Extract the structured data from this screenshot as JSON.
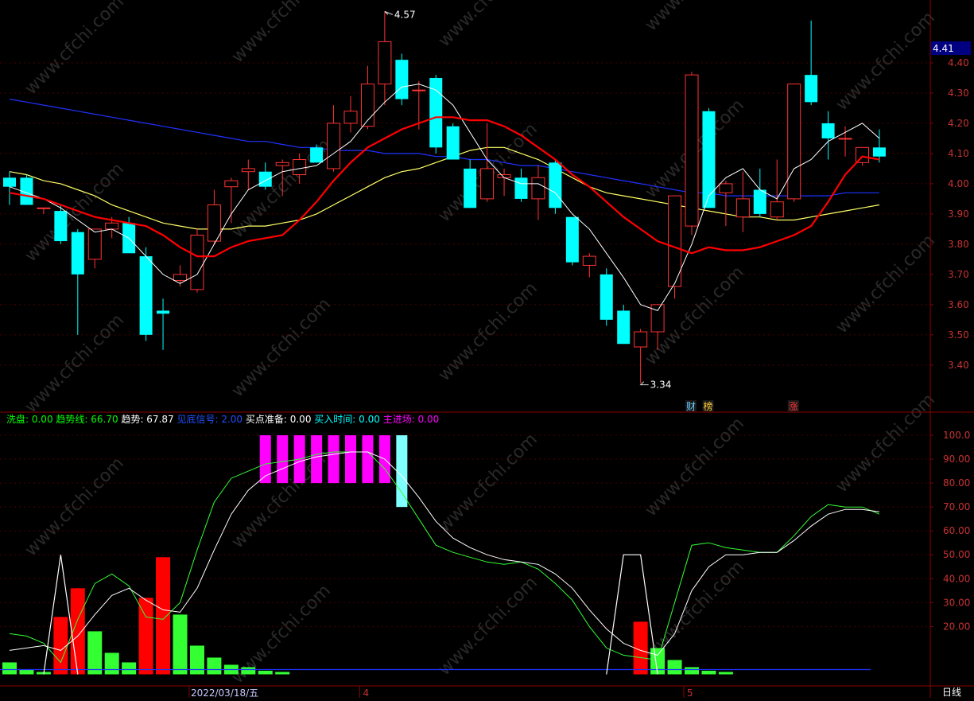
{
  "colors": {
    "bg": "#000000",
    "frame": "#8b0000",
    "grid": "#4a0000",
    "axis_text": "#c83232",
    "up": "#ff3232",
    "down": "#00ffff",
    "ma5": "#ffffff",
    "ma10": "#ff0000",
    "ma20": "#ffff66",
    "ma60": "#1e32ff",
    "price_tag": "#000080"
  },
  "price_axis": {
    "ticks": [
      "4.40",
      "4.30",
      "4.20",
      "4.10",
      "4.00",
      "3.90",
      "3.80",
      "3.70",
      "3.60",
      "3.50",
      "3.40"
    ],
    "last": "4.41"
  },
  "annotations": {
    "high": "4.57",
    "low": "3.34"
  },
  "markers": [
    {
      "text": "财",
      "color": "#66ccff",
      "bar": 40
    },
    {
      "text": "榜",
      "color": "#ffcc33",
      "bar": 41
    },
    {
      "text": "涨",
      "color": "#ff3333",
      "bar": 46
    }
  ],
  "indicator_legend": [
    {
      "label": "洗盘:",
      "value": "0.00",
      "color": "#00ff00"
    },
    {
      "label": "趋势线:",
      "value": "66.70",
      "color": "#00ff00"
    },
    {
      "label": "趋势:",
      "value": "67.87",
      "color": "#ffffff"
    },
    {
      "label": "见底信号:",
      "value": "2.00",
      "color": "#1e50ff"
    },
    {
      "label": "买点准备:",
      "value": "0.00",
      "color": "#ffffff"
    },
    {
      "label": "买入时间:",
      "value": "0.00",
      "color": "#00ffff"
    },
    {
      "label": "主进场:",
      "value": "0.00",
      "color": "#ff00ff"
    }
  ],
  "ind_axis": {
    "ticks": [
      "100.0",
      "90.00",
      "80.00",
      "70.00",
      "60.00",
      "50.00",
      "40.00",
      "30.00",
      "20.00"
    ]
  },
  "date_axis": {
    "labels": [
      {
        "text": "2022/03/18/五",
        "bar": 11
      },
      {
        "text": "4",
        "bar": 21
      },
      {
        "text": "5",
        "bar": 40
      }
    ],
    "period": "日线"
  },
  "watermark": "www.cfchi.com",
  "chart_data": {
    "type": "candlestick",
    "ylim": [
      3.31,
      4.6
    ],
    "candles": [
      {
        "o": 4.02,
        "h": 4.04,
        "l": 3.93,
        "c": 3.99
      },
      {
        "o": 4.02,
        "h": 4.03,
        "l": 3.94,
        "c": 3.93
      },
      {
        "o": 3.92,
        "h": 3.92,
        "l": 3.9,
        "c": 3.92
      },
      {
        "o": 3.91,
        "h": 3.93,
        "l": 3.8,
        "c": 3.81
      },
      {
        "o": 3.84,
        "h": 3.85,
        "l": 3.5,
        "c": 3.7
      },
      {
        "o": 3.75,
        "h": 3.85,
        "l": 3.72,
        "c": 3.85
      },
      {
        "o": 3.85,
        "h": 3.89,
        "l": 3.82,
        "c": 3.87
      },
      {
        "o": 3.87,
        "h": 3.89,
        "l": 3.83,
        "c": 3.77
      },
      {
        "o": 3.76,
        "h": 3.79,
        "l": 3.48,
        "c": 3.5
      },
      {
        "o": 3.58,
        "h": 3.62,
        "l": 3.45,
        "c": 3.57
      },
      {
        "o": 3.68,
        "h": 3.73,
        "l": 3.66,
        "c": 3.7
      },
      {
        "o": 3.65,
        "h": 3.85,
        "l": 3.64,
        "c": 3.83
      },
      {
        "o": 3.81,
        "h": 3.98,
        "l": 3.8,
        "c": 3.93
      },
      {
        "o": 3.99,
        "h": 4.02,
        "l": 3.87,
        "c": 4.01
      },
      {
        "o": 4.04,
        "h": 4.08,
        "l": 3.98,
        "c": 4.05
      },
      {
        "o": 4.04,
        "h": 4.07,
        "l": 3.98,
        "c": 3.99
      },
      {
        "o": 4.06,
        "h": 4.08,
        "l": 3.96,
        "c": 4.07
      },
      {
        "o": 4.03,
        "h": 4.1,
        "l": 4.0,
        "c": 4.08
      },
      {
        "o": 4.12,
        "h": 4.13,
        "l": 4.07,
        "c": 4.07
      },
      {
        "o": 4.05,
        "h": 4.26,
        "l": 4.04,
        "c": 4.2
      },
      {
        "o": 4.2,
        "h": 4.29,
        "l": 4.17,
        "c": 4.24
      },
      {
        "o": 4.19,
        "h": 4.39,
        "l": 4.18,
        "c": 4.33
      },
      {
        "o": 4.33,
        "h": 4.57,
        "l": 4.26,
        "c": 4.47
      },
      {
        "o": 4.41,
        "h": 4.43,
        "l": 4.26,
        "c": 4.28
      },
      {
        "o": 4.31,
        "h": 4.34,
        "l": 4.18,
        "c": 4.31
      },
      {
        "o": 4.35,
        "h": 4.36,
        "l": 4.1,
        "c": 4.12
      },
      {
        "o": 4.19,
        "h": 4.2,
        "l": 4.08,
        "c": 4.08
      },
      {
        "o": 4.05,
        "h": 4.08,
        "l": 3.92,
        "c": 3.92
      },
      {
        "o": 3.95,
        "h": 4.2,
        "l": 3.94,
        "c": 4.05
      },
      {
        "o": 4.02,
        "h": 4.05,
        "l": 3.96,
        "c": 4.03
      },
      {
        "o": 4.02,
        "h": 4.05,
        "l": 3.94,
        "c": 3.95
      },
      {
        "o": 3.95,
        "h": 4.06,
        "l": 3.88,
        "c": 4.02
      },
      {
        "o": 4.07,
        "h": 4.08,
        "l": 3.9,
        "c": 3.92
      },
      {
        "o": 3.89,
        "h": 3.89,
        "l": 3.73,
        "c": 3.74
      },
      {
        "o": 3.73,
        "h": 3.77,
        "l": 3.69,
        "c": 3.76
      },
      {
        "o": 3.7,
        "h": 3.72,
        "l": 3.53,
        "c": 3.55
      },
      {
        "o": 3.58,
        "h": 3.6,
        "l": 3.47,
        "c": 3.47
      },
      {
        "o": 3.46,
        "h": 3.52,
        "l": 3.34,
        "c": 3.51
      },
      {
        "o": 3.51,
        "h": 3.6,
        "l": 3.45,
        "c": 3.6
      },
      {
        "o": 3.66,
        "h": 3.96,
        "l": 3.62,
        "c": 3.96
      },
      {
        "o": 3.86,
        "h": 4.37,
        "l": 3.83,
        "c": 4.36
      },
      {
        "o": 4.24,
        "h": 4.25,
        "l": 3.92,
        "c": 3.92
      },
      {
        "o": 3.97,
        "h": 4.01,
        "l": 3.86,
        "c": 4.0
      },
      {
        "o": 3.89,
        "h": 4.04,
        "l": 3.84,
        "c": 3.95
      },
      {
        "o": 3.98,
        "h": 4.05,
        "l": 3.89,
        "c": 3.9
      },
      {
        "o": 3.89,
        "h": 4.08,
        "l": 3.88,
        "c": 3.94
      },
      {
        "o": 3.95,
        "h": 4.33,
        "l": 3.94,
        "c": 4.33
      },
      {
        "o": 4.36,
        "h": 4.54,
        "l": 4.26,
        "c": 4.27
      },
      {
        "o": 4.2,
        "h": 4.24,
        "l": 4.08,
        "c": 4.15
      },
      {
        "o": 4.15,
        "h": 4.19,
        "l": 4.09,
        "c": 4.15
      },
      {
        "o": 4.07,
        "h": 4.12,
        "l": 4.06,
        "c": 4.12
      },
      {
        "o": 4.12,
        "h": 4.18,
        "l": 4.07,
        "c": 4.09
      }
    ],
    "ma5": [
      3.99,
      3.97,
      3.95,
      3.92,
      3.88,
      3.84,
      3.85,
      3.82,
      3.76,
      3.7,
      3.67,
      3.7,
      3.8,
      3.9,
      3.98,
      4.01,
      4.04,
      4.05,
      4.06,
      4.1,
      4.14,
      4.21,
      4.27,
      4.32,
      4.33,
      4.31,
      4.26,
      4.17,
      4.08,
      4.02,
      4.0,
      4.0,
      3.97,
      3.9,
      3.85,
      3.77,
      3.69,
      3.6,
      3.58,
      3.67,
      3.8,
      3.96,
      4.02,
      4.05,
      3.98,
      3.95,
      4.05,
      4.08,
      4.14,
      4.17,
      4.2,
      4.15
    ],
    "ma10": [
      3.97,
      3.96,
      3.95,
      3.93,
      3.91,
      3.89,
      3.88,
      3.87,
      3.86,
      3.83,
      3.79,
      3.76,
      3.76,
      3.79,
      3.81,
      3.82,
      3.83,
      3.88,
      3.94,
      4.01,
      4.07,
      4.12,
      4.15,
      4.18,
      4.2,
      4.22,
      4.22,
      4.21,
      4.21,
      4.19,
      4.16,
      4.12,
      4.08,
      4.03,
      3.99,
      3.94,
      3.89,
      3.85,
      3.81,
      3.79,
      3.77,
      3.79,
      3.78,
      3.78,
      3.79,
      3.81,
      3.83,
      3.86,
      3.94,
      4.03,
      4.09,
      4.08
    ],
    "ma20": [
      4.04,
      4.03,
      4.01,
      4.0,
      3.98,
      3.96,
      3.93,
      3.91,
      3.89,
      3.87,
      3.86,
      3.85,
      3.85,
      3.85,
      3.86,
      3.86,
      3.87,
      3.88,
      3.9,
      3.93,
      3.96,
      3.99,
      4.02,
      4.04,
      4.05,
      4.07,
      4.09,
      4.11,
      4.12,
      4.12,
      4.1,
      4.08,
      4.05,
      4.02,
      3.99,
      3.97,
      3.96,
      3.95,
      3.94,
      3.93,
      3.92,
      3.91,
      3.9,
      3.89,
      3.89,
      3.88,
      3.88,
      3.89,
      3.9,
      3.91,
      3.92,
      3.93
    ],
    "ma60": [
      4.28,
      4.27,
      4.26,
      4.25,
      4.24,
      4.23,
      4.22,
      4.21,
      4.2,
      4.19,
      4.18,
      4.17,
      4.16,
      4.15,
      4.14,
      4.14,
      4.13,
      4.12,
      4.12,
      4.11,
      4.11,
      4.11,
      4.1,
      4.1,
      4.1,
      4.09,
      4.09,
      4.08,
      4.08,
      4.07,
      4.06,
      4.06,
      4.05,
      4.04,
      4.03,
      4.02,
      4.01,
      4.0,
      3.99,
      3.98,
      3.97,
      3.97,
      3.96,
      3.96,
      3.96,
      3.96,
      3.96,
      3.96,
      3.96,
      3.97,
      3.97,
      3.97
    ],
    "indicator": {
      "ylim": [
        -3.5,
        102
      ],
      "bars": [
        {
          "i": 0,
          "v": 5,
          "c": "g"
        },
        {
          "i": 1,
          "v": 2,
          "c": "g"
        },
        {
          "i": 2,
          "v": 1,
          "c": "g"
        },
        {
          "i": 3,
          "v": 24,
          "c": "r"
        },
        {
          "i": 4,
          "v": 36,
          "c": "r"
        },
        {
          "i": 5,
          "v": 18,
          "c": "g"
        },
        {
          "i": 6,
          "v": 9,
          "c": "g"
        },
        {
          "i": 7,
          "v": 5,
          "c": "g"
        },
        {
          "i": 8,
          "v": 32,
          "c": "r"
        },
        {
          "i": 9,
          "v": 49,
          "c": "r"
        },
        {
          "i": 10,
          "v": 25,
          "c": "g"
        },
        {
          "i": 11,
          "v": 12,
          "c": "g"
        },
        {
          "i": 12,
          "v": 7,
          "c": "g"
        },
        {
          "i": 13,
          "v": 4,
          "c": "g"
        },
        {
          "i": 14,
          "v": 3,
          "c": "g"
        },
        {
          "i": 15,
          "v": 1.5,
          "c": "g"
        },
        {
          "i": 16,
          "v": 1,
          "c": "g"
        },
        {
          "i": 37,
          "v": 22,
          "c": "r"
        },
        {
          "i": 38,
          "v": 11,
          "c": "g"
        },
        {
          "i": 39,
          "v": 6,
          "c": "g"
        },
        {
          "i": 40,
          "v": 3,
          "c": "g"
        },
        {
          "i": 41,
          "v": 1.5,
          "c": "g"
        },
        {
          "i": 42,
          "v": 1,
          "c": "g"
        }
      ],
      "main_bars": [
        {
          "i": 15,
          "from": 80,
          "to": 100,
          "c": "#ff00ff"
        },
        {
          "i": 16,
          "from": 80,
          "to": 100,
          "c": "#ff00ff"
        },
        {
          "i": 17,
          "from": 80,
          "to": 100,
          "c": "#ff00ff"
        },
        {
          "i": 18,
          "from": 80,
          "to": 100,
          "c": "#ff00ff"
        },
        {
          "i": 19,
          "from": 80,
          "to": 100,
          "c": "#ff00ff"
        },
        {
          "i": 20,
          "from": 80,
          "to": 100,
          "c": "#ff00ff"
        },
        {
          "i": 21,
          "from": 80,
          "to": 100,
          "c": "#ff00ff"
        },
        {
          "i": 22,
          "from": 80,
          "to": 100,
          "c": "#ff00ff"
        },
        {
          "i": 23,
          "from": 70,
          "to": 100,
          "c": "#80ffff"
        }
      ],
      "trend_green": [
        17,
        16,
        13,
        5,
        23,
        38,
        42,
        37,
        24,
        23,
        30,
        52,
        72,
        82,
        85,
        88,
        89,
        90,
        92,
        93,
        93,
        93,
        86,
        76,
        65,
        54,
        51,
        49,
        47,
        46,
        47,
        44,
        38,
        31,
        20,
        11,
        8,
        7,
        6,
        30,
        54,
        55,
        53,
        52,
        51,
        51,
        58,
        66,
        71,
        70,
        70,
        67
      ],
      "trend_white": [
        10,
        11,
        12,
        10,
        16,
        25,
        33,
        36,
        31,
        27,
        26,
        36,
        52,
        67,
        77,
        83,
        86,
        89,
        91,
        92,
        93,
        93,
        90,
        83,
        74,
        64,
        57,
        53,
        50,
        48,
        47,
        46,
        42,
        36,
        27,
        19,
        13,
        10,
        8,
        17,
        35,
        45,
        50,
        50,
        51,
        51,
        56,
        62,
        67,
        69,
        69,
        68
      ],
      "signal_white": [
        {
          "i": 2,
          "v": 0
        },
        {
          "i": 3,
          "v": 50
        },
        {
          "i": 4,
          "v": 0
        },
        {
          "i": 35,
          "v": 0
        },
        {
          "i": 36,
          "v": 50
        },
        {
          "i": 37,
          "v": 50
        },
        {
          "i": 38,
          "v": 0
        }
      ],
      "blue_line": 2
    }
  }
}
